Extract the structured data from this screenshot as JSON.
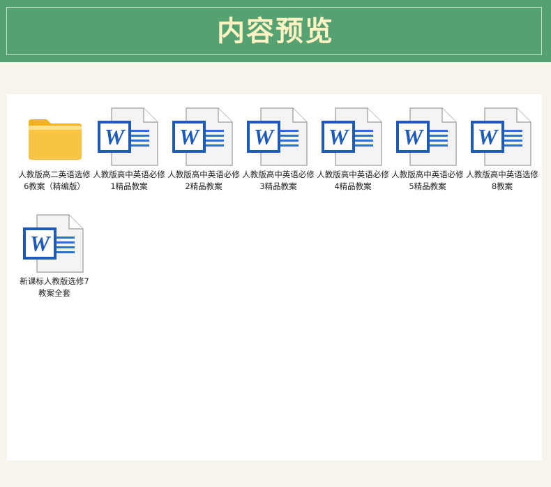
{
  "header": {
    "title": "内容预览"
  },
  "files": [
    {
      "name": "人教版高二英语选修6教案（精编版）",
      "icon": "folder-icon"
    },
    {
      "name": "人教版高中英语必修1精品教案",
      "icon": "word-doc-icon"
    },
    {
      "name": "人教版高中英语必修2精品教案",
      "icon": "word-doc-icon"
    },
    {
      "name": "人教版高中英语必修3精品教案",
      "icon": "word-doc-icon"
    },
    {
      "name": "人教版高中英语必修4精品教案",
      "icon": "word-doc-icon"
    },
    {
      "name": "人教版高中英语必修5精品教案",
      "icon": "word-doc-icon"
    },
    {
      "name": "人教版高中英语选修8教案",
      "icon": "word-doc-icon"
    },
    {
      "name": "新课标人教版选修7教案全套",
      "icon": "word-doc-icon"
    }
  ],
  "colors": {
    "header_bg": "#55a171",
    "title": "#fdf3c4",
    "word_blue": "#1e5bb8",
    "folder": "#f7c543"
  }
}
